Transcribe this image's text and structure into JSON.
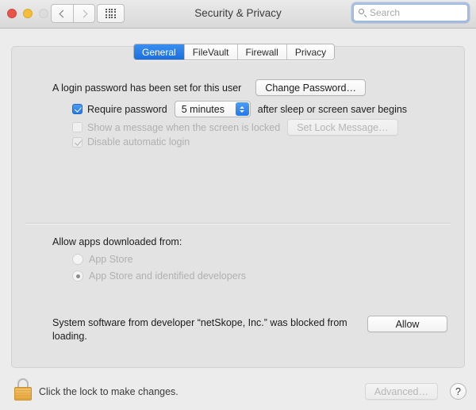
{
  "window": {
    "title": "Security & Privacy",
    "traffic_lights": [
      "close",
      "minimize",
      "zoom"
    ],
    "nav": {
      "back": "‹",
      "forward": "›",
      "show_all": "show-all-grid"
    },
    "search": {
      "placeholder": "Search",
      "value": ""
    }
  },
  "tabs": [
    {
      "label": "General",
      "active": true
    },
    {
      "label": "FileVault",
      "active": false
    },
    {
      "label": "Firewall",
      "active": false
    },
    {
      "label": "Privacy",
      "active": false
    }
  ],
  "general": {
    "login_password_text": "A login password has been set for this user",
    "change_password_label": "Change Password…",
    "require_password": {
      "label": "Require password",
      "checked": true,
      "enabled": true,
      "delay_value": "5 minutes",
      "suffix": "after sleep or screen saver begins"
    },
    "lock_message": {
      "label": "Show a message when the screen is locked",
      "checked": false,
      "enabled": false,
      "button_label": "Set Lock Message…"
    },
    "disable_auto_login": {
      "label": "Disable automatic login",
      "checked": true,
      "enabled": false
    },
    "allow_apps": {
      "heading": "Allow apps downloaded from:",
      "options": [
        {
          "label": "App Store",
          "selected": false
        },
        {
          "label": "App Store and identified developers",
          "selected": true
        }
      ],
      "enabled": false
    },
    "blocked_notice": {
      "text": "System software from developer “netSkope, Inc.” was blocked from loading.",
      "button_label": "Allow"
    }
  },
  "bottom_bar": {
    "lock_icon": "closed-padlock-icon",
    "lock_text": "Click the lock to make changes.",
    "advanced_label": "Advanced…",
    "advanced_enabled": false,
    "help_label": "?"
  },
  "colors": {
    "accent_blue": "#2379e8",
    "window_bg": "#ececec",
    "panel_bg": "#e3e3e3",
    "lock_gold": "#e9a93f"
  }
}
